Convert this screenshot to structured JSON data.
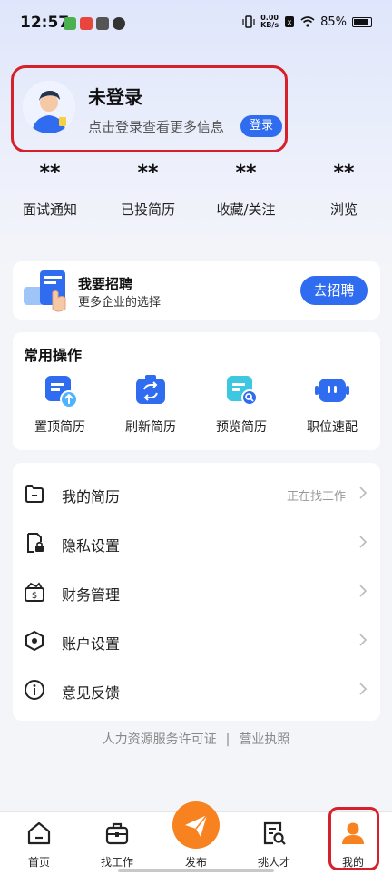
{
  "status_bar": {
    "time": "12:57",
    "net_speed_value": "0.00",
    "net_speed_unit": "KB/s",
    "battery": "85%"
  },
  "profile": {
    "name": "未登录",
    "hint": "点击登录查看更多信息",
    "login_label": "登录"
  },
  "stats": [
    {
      "value": "**",
      "label": "面试通知"
    },
    {
      "value": "**",
      "label": "已投简历"
    },
    {
      "value": "**",
      "label": "收藏/关注"
    },
    {
      "value": "**",
      "label": "浏览"
    }
  ],
  "recruit": {
    "title": "我要招聘",
    "subtitle": "更多企业的选择",
    "button": "去招聘"
  },
  "common_ops": {
    "title": "常用操作",
    "items": [
      {
        "label": "置顶简历",
        "icon": "resume-top-icon"
      },
      {
        "label": "刷新简历",
        "icon": "refresh-resume-icon"
      },
      {
        "label": "预览简历",
        "icon": "preview-resume-icon"
      },
      {
        "label": "职位速配",
        "icon": "job-match-icon"
      }
    ]
  },
  "menu": [
    {
      "label": "我的简历",
      "right": "正在找工作",
      "icon": "folder-icon"
    },
    {
      "label": "隐私设置",
      "right": "",
      "icon": "lock-doc-icon"
    },
    {
      "label": "财务管理",
      "right": "",
      "icon": "wallet-icon"
    },
    {
      "label": "账户设置",
      "right": "",
      "icon": "hexagon-settings-icon"
    },
    {
      "label": "意见反馈",
      "right": "",
      "icon": "info-icon"
    }
  ],
  "footer": {
    "license": "人力资源服务许可证",
    "separator": "|",
    "business": "营业执照"
  },
  "tabbar": [
    {
      "label": "首页",
      "icon": "home-icon"
    },
    {
      "label": "找工作",
      "icon": "briefcase-icon"
    },
    {
      "label": "发布",
      "icon": "send-icon"
    },
    {
      "label": "挑人才",
      "icon": "search-doc-icon"
    },
    {
      "label": "我的",
      "icon": "user-icon"
    }
  ],
  "colors": {
    "accent": "#2f6cf0",
    "publish": "#f7821f",
    "active_tab": "#f7821f",
    "highlight_border": "#d6202a"
  }
}
